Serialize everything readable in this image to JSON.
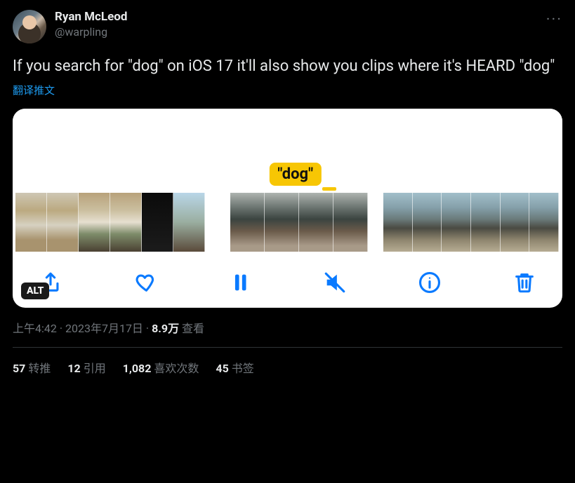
{
  "author": {
    "display_name": "Ryan McLeod",
    "handle": "@warpling"
  },
  "tweet_text": "If you search for \"dog\" on iOS 17 it'll also show you clips where it's HEARD \"dog\"",
  "translate_label": "翻译推文",
  "media": {
    "caption_pill": "\"dog\"",
    "alt_badge": "ALT"
  },
  "meta": {
    "time": "上午4:42",
    "dot1": " · ",
    "date": "2023年7月17日",
    "dot2": " · ",
    "views_count": "8.9万",
    "views_label": " 查看"
  },
  "stats": {
    "retweets_count": "57",
    "retweets_label": "转推",
    "quotes_count": "12",
    "quotes_label": "引用",
    "likes_count": "1,082",
    "likes_label": "喜欢次数",
    "bookmarks_count": "45",
    "bookmarks_label": "书签"
  }
}
